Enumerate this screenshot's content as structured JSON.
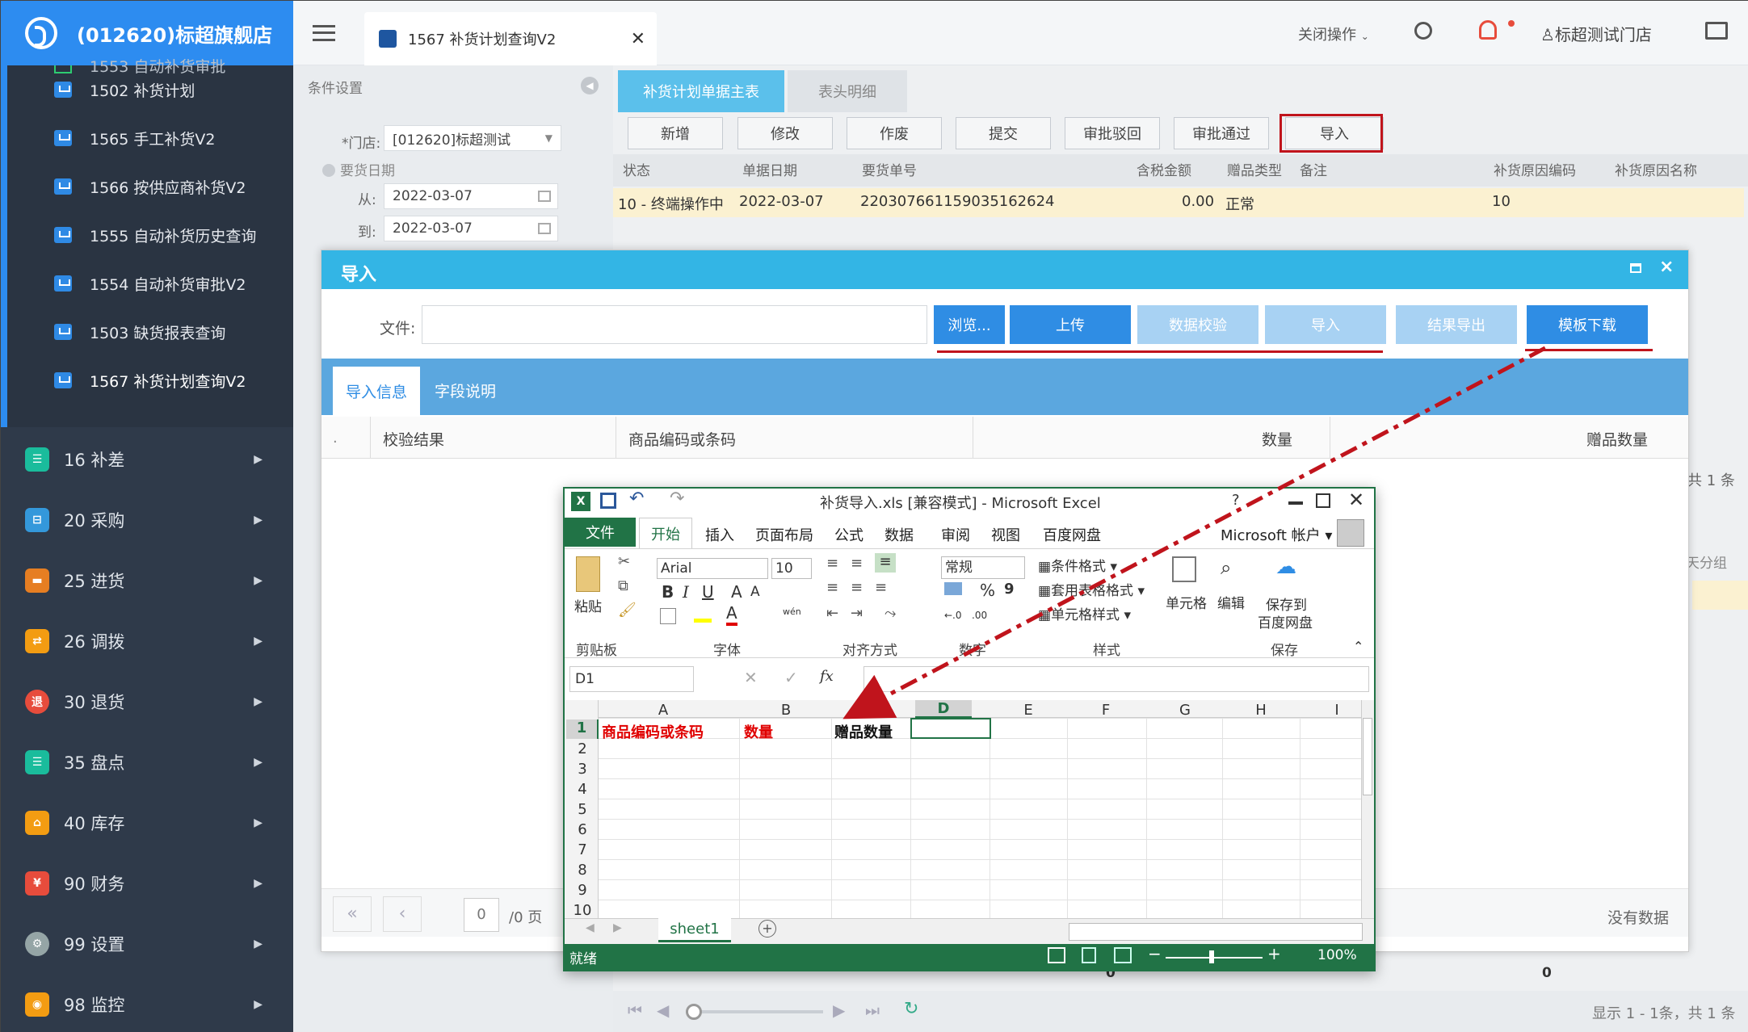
{
  "sidebar": {
    "brand": "(012620)标超旗舰店",
    "partial_item": "1553 自动补货审批",
    "subitems": [
      {
        "label": "1502 补货计划"
      },
      {
        "label": "1565 手工补货V2"
      },
      {
        "label": "1566 按供应商补货V2"
      },
      {
        "label": "1555 自动补货历史查询"
      },
      {
        "label": "1554 自动补货审批V2"
      },
      {
        "label": "1503 缺货报表查询"
      },
      {
        "label": "1567 补货计划查询V2"
      }
    ],
    "menus": [
      {
        "label": "16 补差",
        "icon": "list-icon",
        "color": "#1abc9c"
      },
      {
        "label": "20 采购",
        "icon": "basket-icon",
        "color": "#3498db"
      },
      {
        "label": "25 进货",
        "icon": "truck-icon",
        "color": "#e67e22"
      },
      {
        "label": "26 调拨",
        "icon": "transfer-icon",
        "color": "#f39c12"
      },
      {
        "label": "30 退货",
        "icon": "return-icon",
        "color": "#e74c3c"
      },
      {
        "label": "35 盘点",
        "icon": "clipboard-icon",
        "color": "#1abc9c"
      },
      {
        "label": "40 库存",
        "icon": "warehouse-icon",
        "color": "#f39c12"
      },
      {
        "label": "90 财务",
        "icon": "finance-icon",
        "color": "#e74c3c"
      },
      {
        "label": "99 设置",
        "icon": "gear-icon",
        "color": "#95a5a6"
      },
      {
        "label": "98 监控",
        "icon": "monitor-user-icon",
        "color": "#f39c12"
      }
    ],
    "return_badge": "退",
    "finance_badge": "¥"
  },
  "header": {
    "tab_title": "1567 补货计划查询V2",
    "close_ops": "关闭操作",
    "store": "标超测试门店"
  },
  "conditions": {
    "title": "条件设置",
    "store_label": "*门店:",
    "store_value": "[012620]标超测试",
    "date_label": "要货日期",
    "from_label": "从:",
    "from_value": "2022-03-07",
    "to_label": "到:",
    "to_value": "2022-03-07"
  },
  "main": {
    "tabs": [
      "补货计划单据主表",
      "表头明细"
    ],
    "buttons": [
      "新增",
      "修改",
      "作废",
      "提交",
      "审批驳回",
      "审批通过",
      "导入"
    ],
    "columns": [
      "状态",
      "单据日期",
      "要货单号",
      "含税金额",
      "赠品类型",
      "备注",
      "补货原因编码",
      "补货原因名称"
    ],
    "row": {
      "status": "10 - 终端操作中",
      "date": "2022-03-07",
      "order_no": "220307661159035162624",
      "amount": "0.00",
      "gift_type": "正常",
      "reason_code": "10"
    },
    "total_right": "共 1 条",
    "side_text": "天分组",
    "bottom_zero_1": "0",
    "bottom_zero_2": "0",
    "pager_info": "显示 1 - 1条，共 1 条"
  },
  "modal": {
    "title": "导入",
    "file_label": "文件:",
    "buttons": [
      "浏览...",
      "上传",
      "数据校验",
      "导入",
      "结果导出",
      "模板下载"
    ],
    "tabs": [
      "导入信息",
      "字段说明"
    ],
    "grid_columns": [
      "校验结果",
      "商品编码或条码",
      "数量",
      "赠品数量"
    ],
    "grid_dot": ".",
    "pager_page": "0",
    "pager_total": "/0 页",
    "no_data": "没有数据"
  },
  "excel": {
    "title": "补货导入.xls [兼容模式] - Microsoft Excel",
    "help": "?",
    "file_tab": "文件",
    "ribbon_tabs": [
      "开始",
      "插入",
      "页面布局",
      "公式",
      "数据",
      "审阅",
      "视图",
      "百度网盘"
    ],
    "account": "Microsoft 帐户",
    "font_name": "Arial",
    "font_size": "10",
    "number_format": "常规",
    "paste_label": "粘贴",
    "cond_format": "条件格式",
    "table_format": "套用表格格式",
    "cell_style": "单元格样式",
    "cells_label": "单元格",
    "edit_label": "编辑",
    "save_to": "保存到",
    "baidu": "百度网盘",
    "groups": [
      "剪贴板",
      "字体",
      "对齐方式",
      "数字",
      "样式",
      "保存"
    ],
    "name_box": "D1",
    "fx": "fx",
    "columns": [
      "A",
      "B",
      "C",
      "D",
      "E",
      "F",
      "G",
      "H",
      "I"
    ],
    "rows": [
      "1",
      "2",
      "3",
      "4",
      "5",
      "6",
      "7",
      "8",
      "9",
      "10"
    ],
    "cells": {
      "A1": "商品编码或条码",
      "B1": "数量",
      "C1": "赠品数量"
    },
    "sheet": "sheet1",
    "status": "就绪",
    "zoom": "100%",
    "wen": "wén",
    "percent": "%",
    "comma": "9"
  }
}
